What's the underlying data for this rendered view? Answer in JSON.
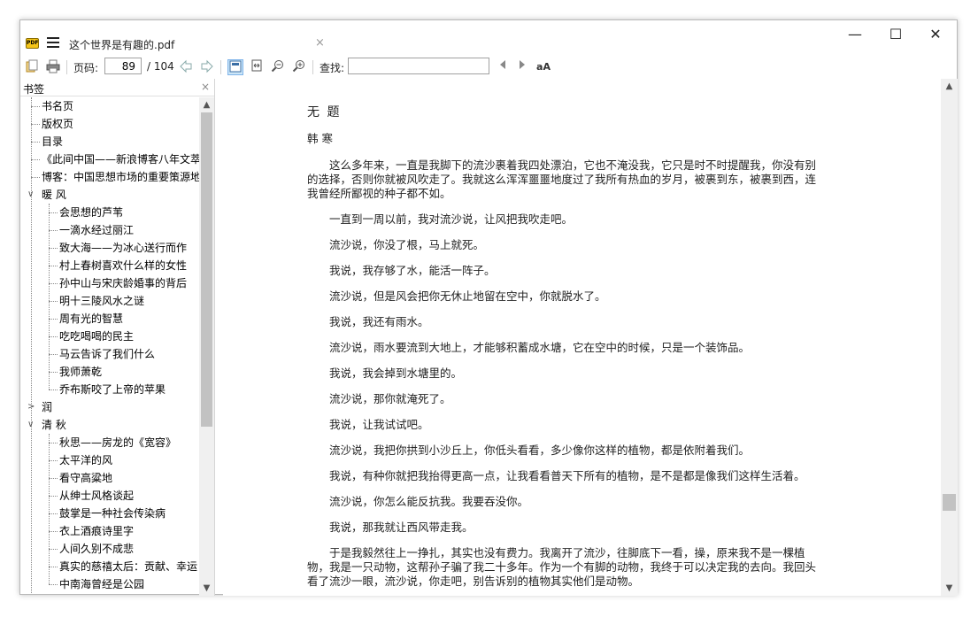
{
  "window": {
    "tab_title": "这个世界是有趣的.pdf",
    "minimize_glyph": "—",
    "maximize_glyph": "☐",
    "close_glyph": "✕",
    "tab_close_glyph": "×",
    "app_icon_text": "PDF"
  },
  "toolbar": {
    "page_label": "页码:",
    "current_page": "89",
    "total_pages": "/ 104",
    "find_label": "查找:",
    "find_value": "",
    "icons": [
      "open-icon",
      "print-icon",
      "prev-page-icon",
      "next-page-icon",
      "fit-page-icon",
      "fit-width-icon",
      "zoom-out-icon",
      "zoom-in-icon",
      "find-prev-icon",
      "find-next-icon",
      "match-case-icon"
    ]
  },
  "sidebar": {
    "title": "书签",
    "close_glyph": "×",
    "items": [
      {
        "label": "书名页",
        "level": 0,
        "expander": ""
      },
      {
        "label": "版权页",
        "level": 0,
        "expander": ""
      },
      {
        "label": "目录",
        "level": 0,
        "expander": ""
      },
      {
        "label": "《此间中国——新浪博客八年文萃",
        "level": 0,
        "expander": ""
      },
      {
        "label": "博客：中国思想市场的重要策源地",
        "level": 0,
        "expander": ""
      },
      {
        "label": "暖 风",
        "level": 0,
        "expander": "∨"
      },
      {
        "label": "会思想的芦苇",
        "level": 1,
        "expander": ""
      },
      {
        "label": "一滴水经过丽江",
        "level": 1,
        "expander": ""
      },
      {
        "label": "致大海——为冰心送行而作",
        "level": 1,
        "expander": ""
      },
      {
        "label": "村上春树喜欢什么样的女性",
        "level": 1,
        "expander": ""
      },
      {
        "label": "孙中山与宋庆龄婚事的背后",
        "level": 1,
        "expander": ""
      },
      {
        "label": "明十三陵风水之谜",
        "level": 1,
        "expander": ""
      },
      {
        "label": "周有光的智慧",
        "level": 1,
        "expander": ""
      },
      {
        "label": "吃吃喝喝的民主",
        "level": 1,
        "expander": ""
      },
      {
        "label": "马云告诉了我们什么",
        "level": 1,
        "expander": ""
      },
      {
        "label": "我师萧乾",
        "level": 1,
        "expander": ""
      },
      {
        "label": "乔布斯咬了上帝的苹果",
        "level": 1,
        "expander": ""
      },
      {
        "label": "润",
        "level": 0,
        "expander": ">"
      },
      {
        "label": "清 秋",
        "level": 0,
        "expander": "∨"
      },
      {
        "label": "秋思——房龙的《宽容》",
        "level": 1,
        "expander": ""
      },
      {
        "label": "太平洋的风",
        "level": 1,
        "expander": ""
      },
      {
        "label": "看守高粱地",
        "level": 1,
        "expander": ""
      },
      {
        "label": "从绅士风格谈起",
        "level": 1,
        "expander": ""
      },
      {
        "label": "鼓掌是一种社会传染病",
        "level": 1,
        "expander": ""
      },
      {
        "label": "衣上酒痕诗里字",
        "level": 1,
        "expander": ""
      },
      {
        "label": "人间久别不成悲",
        "level": 1,
        "expander": ""
      },
      {
        "label": "真实的慈禧太后：贡献、幸运",
        "level": 1,
        "expander": ""
      },
      {
        "label": "中南海曾经是公园",
        "level": 1,
        "expander": ""
      }
    ]
  },
  "document": {
    "title": "无  题",
    "author": "韩  寒",
    "paragraphs": [
      {
        "text": "这么多年来，一直是我脚下的流沙裹着我四处漂泊，它也不淹没我，它只是时不时提醒我，你没有别的选择，否则你就被风吹走了。我就这么浑浑噩噩地度过了我所有热血的岁月，被裹到东，被裹到西，连我曾经所鄙视的种子都不如。",
        "lines": [
          "　　这么多年来，一直是我脚下的流沙裹着我四处漂泊，它也不淹没我，它只是时不时提醒我，你没有别",
          "的选择，否则你就被风吹走了。我就这么浑浑噩噩地度过了我所有热血的岁月，被裹到东，被裹到西，连",
          "我曾经所鄙视的种子都不如。"
        ]
      },
      {
        "lines": [
          "　　一直到一周以前，我对流沙说，让风把我吹走吧。"
        ]
      },
      {
        "lines": [
          "　　流沙说，你没了根，马上就死。"
        ]
      },
      {
        "lines": [
          "　　我说，我存够了水，能活一阵子。"
        ]
      },
      {
        "lines": [
          "　　流沙说，但是风会把你无休止地留在空中，你就脱水了。"
        ]
      },
      {
        "lines": [
          "　　我说，我还有雨水。"
        ]
      },
      {
        "lines": [
          "　　流沙说，雨水要流到大地上，才能够积蓄成水塘，它在空中的时候，只是一个装饰品。"
        ]
      },
      {
        "lines": [
          "　　我说，我会掉到水塘里的。"
        ]
      },
      {
        "lines": [
          "　　流沙说，那你就淹死了。"
        ]
      },
      {
        "lines": [
          "　　我说，让我试试吧。"
        ]
      },
      {
        "lines": [
          "　　流沙说，我把你拱到小沙丘上，你低头看看，多少像你这样的植物，都是依附着我们。"
        ]
      },
      {
        "lines": [
          "　　我说，有种你就把我抬得更高一点，让我看看普天下所有的植物，是不是都是像我们这样生活着。"
        ]
      },
      {
        "lines": [
          "　　流沙说，你怎么能反抗我。我要吞没你。"
        ]
      },
      {
        "lines": [
          "　　我说，那我就让西风带走我。"
        ]
      },
      {
        "lines": [
          "　　于是我毅然往上一挣扎，其实也没有费力。我离开了流沙，往脚底下一看，操，原来我不是一棵植",
          "物，我是一只动物，这帮孙子骗了我二十多年。作为一个有脚的动物，我终于可以决定我的去向。我回头",
          "看了流沙一眼，流沙说，你走吧，别告诉别的植物其实他们是动物。"
        ]
      }
    ]
  }
}
